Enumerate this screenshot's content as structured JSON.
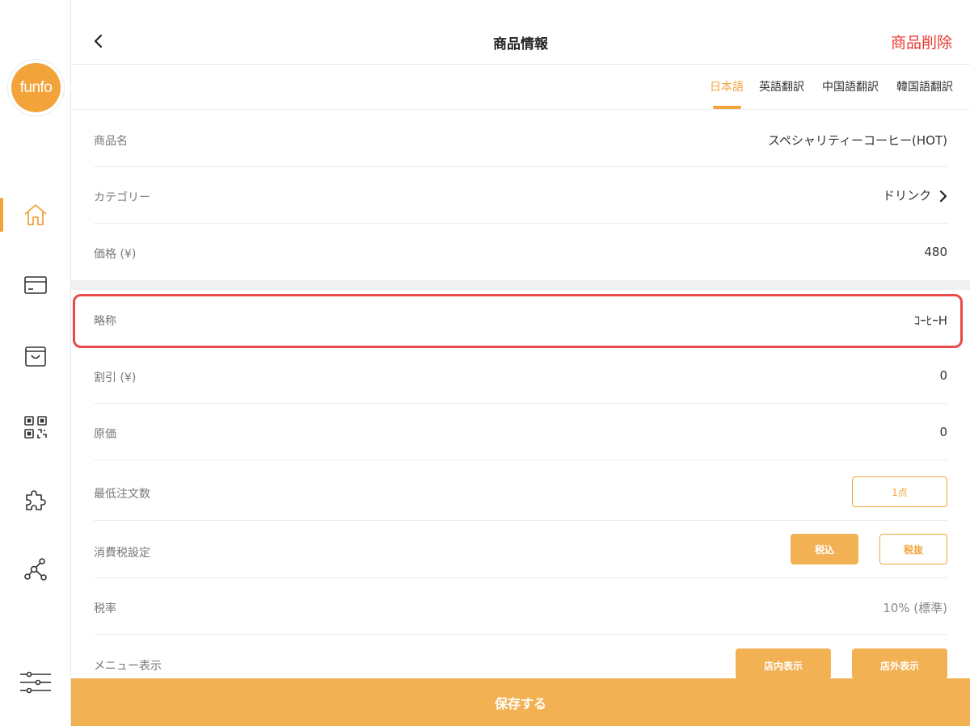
{
  "logo": {
    "text": "funfo"
  },
  "sidebar": {
    "items": [
      {
        "icon": "home-icon",
        "active": true
      },
      {
        "icon": "card-icon",
        "active": false
      },
      {
        "icon": "bag-icon",
        "active": false
      },
      {
        "icon": "qrcode-icon",
        "active": false
      },
      {
        "icon": "puzzle-icon",
        "active": false
      },
      {
        "icon": "network-icon",
        "active": false
      },
      {
        "icon": "sliders-icon",
        "active": false
      }
    ]
  },
  "header": {
    "title": "商品情報",
    "delete_label": "商品削除"
  },
  "tabs": [
    {
      "label": "日本語",
      "active": true
    },
    {
      "label": "英語翻訳",
      "active": false
    },
    {
      "label": "中国語翻訳",
      "active": false
    },
    {
      "label": "韓国語翻訳",
      "active": false
    }
  ],
  "form": {
    "product_name": {
      "label": "商品名",
      "value": "スペシャリティーコーヒー(HOT)"
    },
    "category": {
      "label": "カテゴリー",
      "value": "ドリンク"
    },
    "price": {
      "label": "価格 (¥)",
      "value": "480"
    },
    "abbreviation": {
      "label": "略称",
      "value": "ｺｰﾋｰH"
    },
    "discount": {
      "label": "割引 (¥)",
      "value": "0"
    },
    "cost": {
      "label": "原価",
      "value": "0"
    },
    "min_order": {
      "label": "最低注文数",
      "value": "1点"
    },
    "tax_setting": {
      "label": "消費税設定",
      "options": [
        "税込",
        "税抜"
      ],
      "selected": "税込"
    },
    "tax_rate": {
      "label": "税率",
      "value": "10% (標準)"
    },
    "menu_display": {
      "label": "メニュー表示",
      "options": [
        "店内表示",
        "店外表示"
      ]
    }
  },
  "footer": {
    "save_label": "保存する"
  },
  "colors": {
    "accent": "#f2a33a",
    "danger": "#e8392f",
    "highlight": "#e94a4a"
  }
}
